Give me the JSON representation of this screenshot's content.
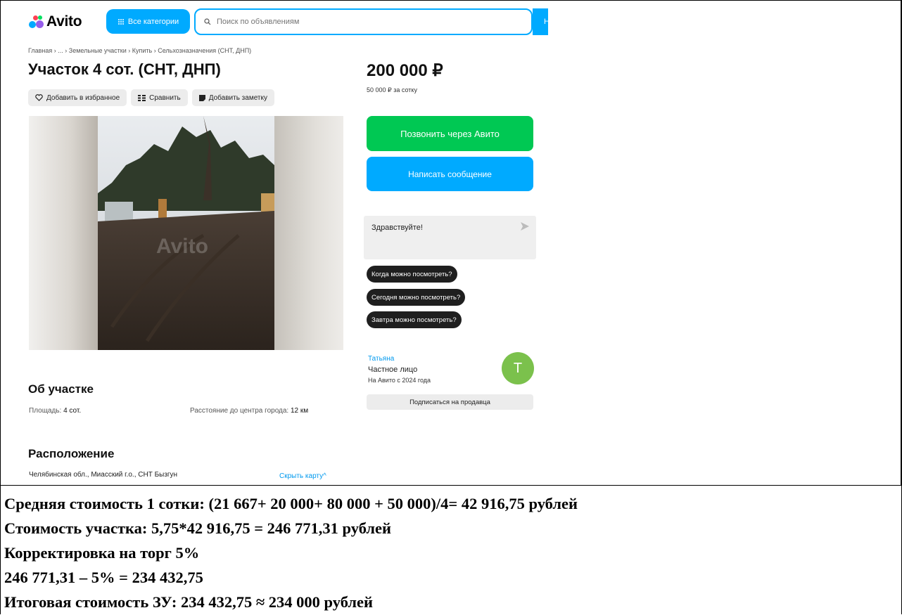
{
  "header": {
    "logo_text": "Avito",
    "categories_label": "Все категории",
    "search_placeholder": "Поиск по объявлениям",
    "search_button_label": "Н"
  },
  "listing": {
    "breadcrumbs": "Главная › ... › Земельные участки › Купить › Сельхозназначения (СНТ, ДНП)",
    "title": "Участок 4 сот. (СНТ, ДНП)",
    "actions": {
      "favorite": "Добавить в избранное",
      "compare": "Сравнить",
      "note": "Добавить заметку"
    },
    "photo_watermark": "Avito",
    "about": {
      "heading": "Об участке",
      "area_label": "Площадь:",
      "area_value": "4 сот.",
      "distance_label": "Расстояние до центра города:",
      "distance_value": "12 км"
    },
    "location": {
      "heading": "Расположение",
      "address": "Челябинская обл., Миасский г.о., СНТ Бызгун",
      "hide_map": "Скрыть карту"
    }
  },
  "sidebar": {
    "price": "200 000 ₽",
    "price_per": "50 000 ₽ за сотку",
    "call_button": "Позвонить через Авито",
    "message_button": "Написать сообщение",
    "message_draft": "Здравствуйте!",
    "quick_replies": [
      "Когда можно посмотреть?",
      "Сегодня можно посмотреть?",
      "Завтра можно посмотреть?"
    ],
    "seller": {
      "name": "Татьяна",
      "type": "Частное лицо",
      "since": "На Авито с 2024 года",
      "initial": "Т",
      "subscribe": "Подписаться на продавца"
    }
  },
  "calculation": [
    "Средняя стоимость 1 сотки: (21 667+ 20 000+ 80 000 + 50 000)/4= 42 916,75 рублей",
    "Стоимость участка: 5,75*42 916,75 = 246 771,31 рублей",
    "Корректировка на торг 5%",
    "246 771,31 – 5% = 234 432,75",
    "Итоговая стоимость ЗУ: 234 432,75 ≈ 234 000 рублей"
  ],
  "colors": {
    "brand_blue": "#00aaff",
    "call_green": "#00c853",
    "avatar_green": "#7bc14c",
    "chip_bg": "#ececec"
  }
}
